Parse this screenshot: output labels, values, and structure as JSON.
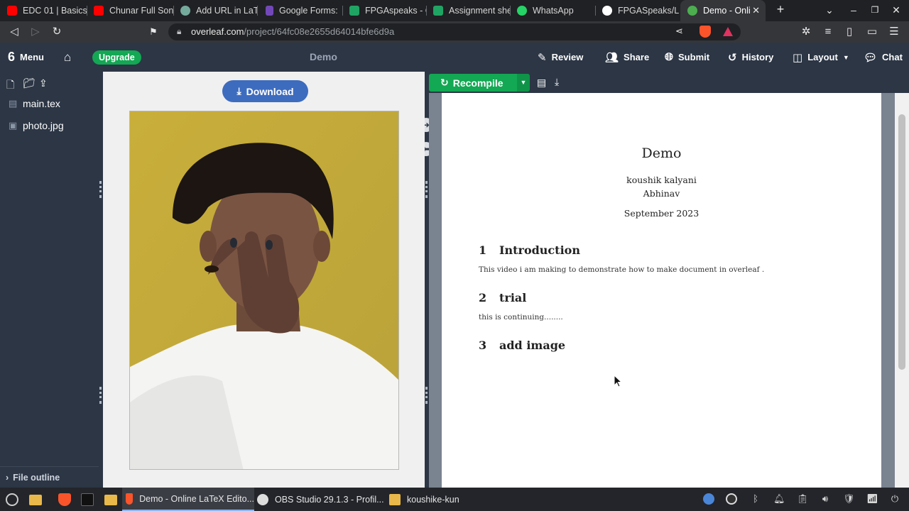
{
  "browser": {
    "tabs": [
      {
        "label": "EDC 01 | Basics",
        "icon": "youtube-icon",
        "color": "#ff0000"
      },
      {
        "label": "Chunar Full Son",
        "icon": "youtube-icon",
        "color": "#ff0000"
      },
      {
        "label": "Add URL in LaTe",
        "icon": "chatgpt-icon",
        "color": "#74aa9c"
      },
      {
        "label": "Google Forms:",
        "icon": "google-forms-icon",
        "color": "#7248b9"
      },
      {
        "label": "FPGAspeaks - C",
        "icon": "google-sheets-icon",
        "color": "#1fa463"
      },
      {
        "label": "Assignment she",
        "icon": "google-sheets-icon",
        "color": "#1fa463"
      },
      {
        "label": "WhatsApp",
        "icon": "whatsapp-icon",
        "color": "#25d366"
      },
      {
        "label": "FPGASpeaks/L",
        "icon": "github-icon",
        "color": "#ffffff"
      },
      {
        "label": "Demo - Onli",
        "icon": "overleaf-icon",
        "color": "#4cae4f",
        "active": true
      }
    ],
    "new_tab": "+",
    "url_host": "overleaf.com",
    "url_path": "/project/64fc08e2655d64014bfe6d9a"
  },
  "overleaf": {
    "menu_label": "Menu",
    "upgrade_label": "Upgrade",
    "project_title": "Demo",
    "toolbar": {
      "review": "Review",
      "share": "Share",
      "submit": "Submit",
      "history": "History",
      "layout": "Layout",
      "chat": "Chat"
    },
    "files": [
      "main.tex",
      "photo.jpg"
    ],
    "file_outline": "File outline",
    "download_label": "Download",
    "recompile_label": "Recompile"
  },
  "pdf": {
    "title": "Demo",
    "authors": [
      "koushik kalyani",
      "Abhinav"
    ],
    "date": "September 2023",
    "sections": [
      {
        "number": "1",
        "title": "Introduction",
        "body": "This video i am making to demonstrate how to make document in overleaf ."
      },
      {
        "number": "2",
        "title": "trial",
        "body": "this is continuing........"
      },
      {
        "number": "3",
        "title": "add image",
        "body": ""
      }
    ]
  },
  "taskbar": {
    "apps": [
      {
        "label": "Demo - Online LaTeX Edito...",
        "icon": "brave-icon",
        "color": "#fb542b",
        "active": true
      },
      {
        "label": "OBS Studio 29.1.3 - Profil...",
        "icon": "obs-icon",
        "color": "#dddddd"
      },
      {
        "label": "koushike-kun",
        "icon": "folder-icon",
        "color": "#e8b84a"
      }
    ]
  },
  "colors": {
    "overleaf_dark": "#2c3645",
    "overleaf_green": "#13a853",
    "download_blue": "#3d6cbf"
  }
}
